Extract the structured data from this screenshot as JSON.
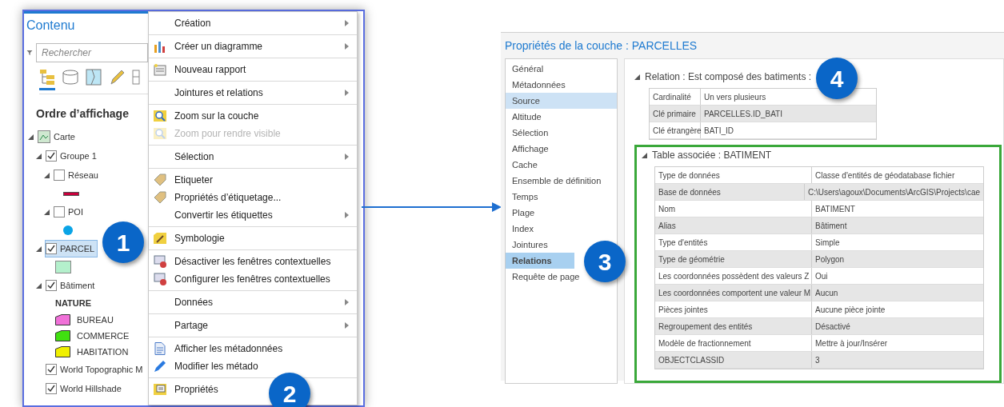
{
  "contents_pane": {
    "title": "Contenu",
    "search": {
      "placeholder": "Rechercher"
    },
    "toolbar": [
      {
        "kind": "tree",
        "selected": true
      },
      {
        "kind": "database",
        "selected": false
      },
      {
        "kind": "map",
        "selected": false
      },
      {
        "kind": "pencil",
        "selected": false
      },
      {
        "kind": "grid",
        "selected": false
      }
    ],
    "heading": "Ordre d’affichage",
    "tree": [
      {
        "label": "Carte",
        "kind": "map",
        "expanded": true,
        "selected": false,
        "children": [
          {
            "label": "Groupe 1",
            "kind": "layer",
            "checked": true,
            "expanded": true,
            "selected": false,
            "children": [
              {
                "label": "Réseau",
                "kind": "layer",
                "checked": false,
                "expanded": true,
                "selected": false,
                "symbol": {
                  "kind": "line",
                  "color": "#c8003c"
                }
              },
              {
                "label": "POI",
                "kind": "layer",
                "checked": false,
                "expanded": true,
                "selected": false,
                "symbol": {
                  "kind": "dot",
                  "color": "#0aa4e6"
                }
              }
            ]
          },
          {
            "label": "PARCEL",
            "kind": "layer",
            "checked": true,
            "expanded": true,
            "selected": true,
            "symbol": {
              "kind": "square",
              "color": "#b4f0cc"
            }
          },
          {
            "label": "Bâtiment",
            "kind": "layer",
            "checked": true,
            "expanded": true,
            "selected": false,
            "legend": {
              "heading": "NATURE",
              "items": [
                {
                  "label": "BUREAU",
                  "color": "#f070d8"
                },
                {
                  "label": "COMMERCE",
                  "color": "#40e010"
                },
                {
                  "label": "HABITATION",
                  "color": "#f0f000"
                }
              ]
            }
          },
          {
            "label": "World Topographic M",
            "kind": "layer",
            "checked": true,
            "selected": false
          },
          {
            "label": "World Hillshade",
            "kind": "layer",
            "checked": true,
            "selected": false
          }
        ]
      }
    ]
  },
  "context_menu": {
    "groups": [
      [
        {
          "label": "Création",
          "submenu": true,
          "disabled": false
        }
      ],
      [
        {
          "label": "Créer un diagramme",
          "kind": "chart",
          "submenu": true,
          "disabled": false
        }
      ],
      [
        {
          "label": "Nouveau rapport",
          "kind": "report",
          "submenu": false,
          "disabled": false
        }
      ],
      [
        {
          "label": "Jointures et relations",
          "submenu": true,
          "disabled": false
        }
      ],
      [
        {
          "label": "Zoom sur la couche",
          "kind": "zoom",
          "submenu": false,
          "disabled": false
        },
        {
          "label": "Zoom pour rendre visible",
          "kind": "zoom",
          "submenu": false,
          "disabled": true
        }
      ],
      [
        {
          "label": "Sélection",
          "submenu": true,
          "disabled": false
        }
      ],
      [
        {
          "label": "Etiqueter",
          "kind": "label",
          "submenu": false,
          "disabled": false
        },
        {
          "label": "Propriétés d’étiquetage...",
          "kind": "label",
          "submenu": false,
          "disabled": false
        },
        {
          "label": "Convertir les étiquettes",
          "submenu": true,
          "disabled": false
        }
      ],
      [
        {
          "label": "Symbologie",
          "kind": "brush",
          "submenu": false,
          "disabled": false
        }
      ],
      [
        {
          "label": "Désactiver les fenêtres contextuelles",
          "kind": "popup",
          "submenu": false,
          "disabled": false
        },
        {
          "label": "Configurer les fenêtres contextuelles",
          "kind": "popup",
          "submenu": false,
          "disabled": false
        }
      ],
      [
        {
          "label": "Données",
          "submenu": true,
          "disabled": false
        }
      ],
      [
        {
          "label": "Partage",
          "submenu": true,
          "disabled": false
        }
      ],
      [
        {
          "label": "Afficher les métadonnées",
          "kind": "document",
          "submenu": false,
          "disabled": false
        },
        {
          "label": "Modifier les métado",
          "kind": "pencil",
          "submenu": false,
          "disabled": false
        }
      ],
      [
        {
          "label": "Propriétés",
          "kind": "properties",
          "submenu": false,
          "disabled": false
        }
      ]
    ]
  },
  "properties_dialog": {
    "title": "Propriétés de la couche : PARCELLES",
    "nav": [
      {
        "label": "Général",
        "selected": false,
        "hovered": false
      },
      {
        "label": "Métadonnées",
        "selected": false,
        "hovered": false
      },
      {
        "label": "Source",
        "selected": false,
        "hovered": true
      },
      {
        "label": "Altitude",
        "selected": false,
        "hovered": false
      },
      {
        "label": "Sélection",
        "selected": false,
        "hovered": false
      },
      {
        "label": "Affichage",
        "selected": false,
        "hovered": false
      },
      {
        "label": "Cache",
        "selected": false,
        "hovered": false
      },
      {
        "label": "Ensemble de définition",
        "selected": false,
        "hovered": false
      },
      {
        "label": "Temps",
        "selected": false,
        "hovered": false
      },
      {
        "label": "Plage",
        "selected": false,
        "hovered": false
      },
      {
        "label": "Index",
        "selected": false,
        "hovered": false
      },
      {
        "label": "Jointures",
        "selected": false,
        "hovered": false
      },
      {
        "label": "Relations",
        "selected": true,
        "hovered": false
      },
      {
        "label": "Requête de page",
        "selected": false,
        "hovered": false
      }
    ],
    "relation": {
      "heading": "Relation : Est composé des batiments :",
      "rows": [
        [
          "Cardinalité",
          "Un vers plusieurs"
        ],
        [
          "Clé primaire",
          "PARCELLES.ID_BATI"
        ],
        [
          "Clé étrangère",
          "BATI_ID"
        ]
      ]
    },
    "related_table": {
      "heading": "Table associée : BATIMENT",
      "rows": [
        [
          "Type de données",
          "Classe d'entités de géodatabase fichier"
        ],
        [
          "Base de données",
          "C:\\Users\\agoux\\Documents\\ArcGIS\\Projects\\cae"
        ],
        [
          "Nom",
          "BATIMENT"
        ],
        [
          "Alias",
          "Bâtiment"
        ],
        [
          "Type d'entités",
          "Simple"
        ],
        [
          "Type de géométrie",
          "Polygon"
        ],
        [
          "Les coordonnées possèdent des valeurs Z",
          "Oui"
        ],
        [
          "Les coordonnées comportent une valeur M",
          "Aucun"
        ],
        [
          "Pièces jointes",
          "Aucune pièce jointe"
        ],
        [
          "Regroupement des entités",
          "Désactivé"
        ],
        [
          "Modèle de fractionnement",
          "Mettre à jour/Insérer"
        ],
        [
          "OBJECTCLASSID",
          "3"
        ]
      ]
    }
  },
  "callouts": [
    "1",
    "2",
    "3",
    "4"
  ]
}
